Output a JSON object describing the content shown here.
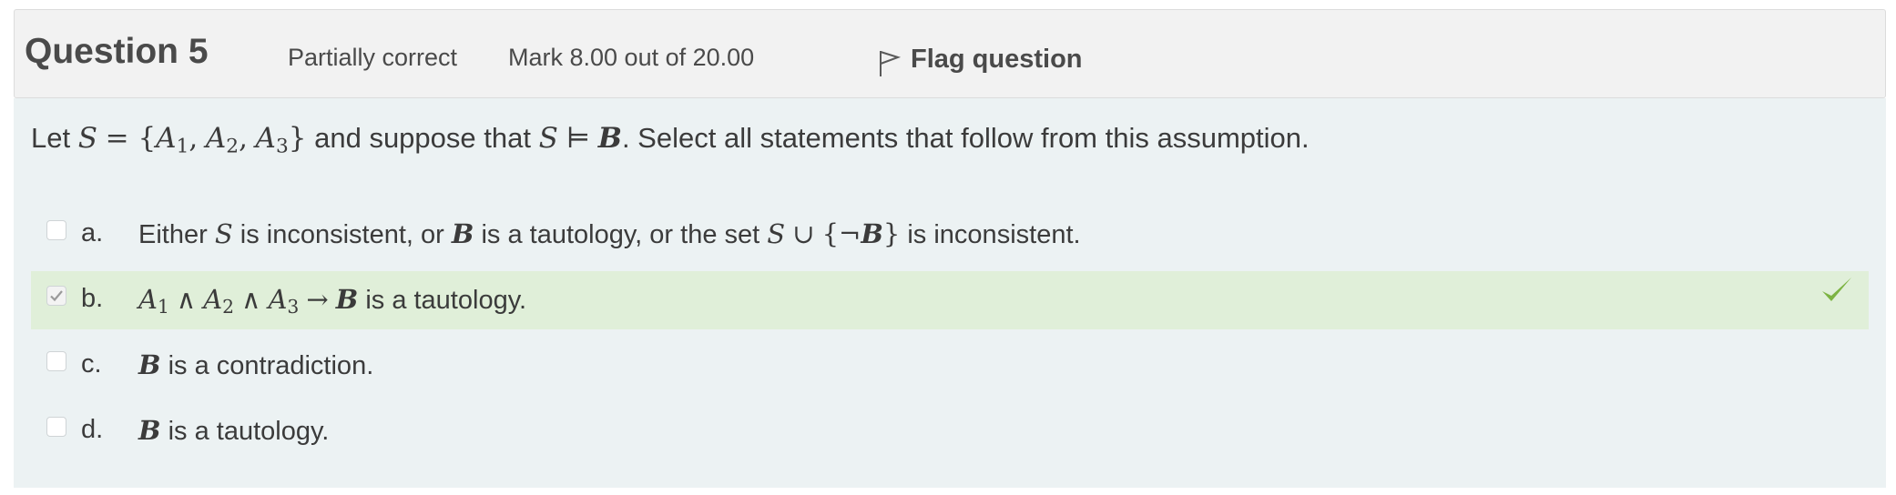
{
  "info": {
    "question_label": "Question",
    "question_number": "5",
    "state": "Partially correct",
    "grade": "Mark 8.00 out of 20.00",
    "flag_label": "Flag question"
  },
  "question_text": {
    "let": "Let",
    "set_S": "S",
    "eq_open": "= {",
    "A": "A",
    "sub1": "1",
    "sub2": "2",
    "sub3": "3",
    "comma": ",",
    "close": "}",
    "and_suppose": "and suppose that",
    "entails": "⊨",
    "B": "B",
    "rest": ". Select all statements that follow from this assumption."
  },
  "options": [
    {
      "letter": "a.",
      "checked": false,
      "correct_tick": false,
      "t1": "Either",
      "S": "S",
      "t2": "is inconsistent, or",
      "B": "B",
      "t3": "is a tautology, or the set",
      "S2": "S",
      "cup": "∪",
      "lbrace": "{¬",
      "B2": "B",
      "rbrace": "}",
      "t4": "is inconsistent."
    },
    {
      "letter": "b.",
      "checked": true,
      "correct_tick": true,
      "A": "A",
      "s1": "1",
      "s2": "2",
      "s3": "3",
      "and": "∧",
      "arrow": "→",
      "B": "B",
      "t1": "is a tautology."
    },
    {
      "letter": "c.",
      "checked": false,
      "correct_tick": false,
      "B": "B",
      "t1": "is a contradiction."
    },
    {
      "letter": "d.",
      "checked": false,
      "correct_tick": false,
      "B": "B",
      "t1": "is a tautology."
    }
  ],
  "colors": {
    "correct_bg": "#e0efd9",
    "tick": "#7cb342",
    "content_bg": "#ecf2f3",
    "info_bg": "#f2f2f2"
  },
  "icons": {
    "flag": "flag-outline-icon",
    "check": "checkmark-icon",
    "box_check": "small-check-icon"
  }
}
